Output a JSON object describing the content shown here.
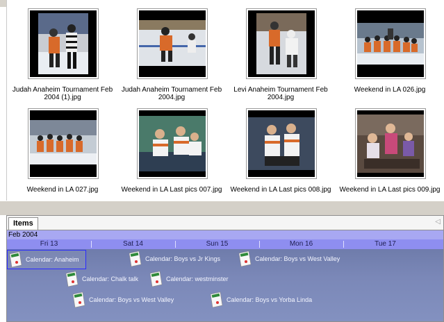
{
  "thumbnails": [
    {
      "caption": "Judah Anaheim Tournament Feb 2004 (1).jpg",
      "icon": "hockey-photo-icon"
    },
    {
      "caption": "Judah Anaheim Tournament Feb 2004.jpg",
      "icon": "hockey-photo-icon"
    },
    {
      "caption": "Levi Anaheim Tournament Feb 2004.jpg",
      "icon": "hockey-photo-icon"
    },
    {
      "caption": "Weekend in LA 026.jpg",
      "icon": "team-photo-icon"
    },
    {
      "caption": "Weekend in LA 027.jpg",
      "icon": "team-photo-icon"
    },
    {
      "caption": "Weekend in LA Last pics 007.jpg",
      "icon": "players-photo-icon"
    },
    {
      "caption": "Weekend in LA Last pics 008.jpg",
      "icon": "players-photo-icon"
    },
    {
      "caption": "Weekend in LA Last pics 009.jpg",
      "icon": "kids-photo-icon"
    }
  ],
  "items_pane": {
    "tab_label": "Items",
    "month_label": "Feb 2004",
    "days": [
      "Fri 13",
      "Sat 14",
      "Sun 15",
      "Mon 16",
      "Tue 17"
    ],
    "events": [
      {
        "label": "Calendar: Anaheim",
        "selected": true
      },
      {
        "label": "Calendar: Boys vs Jr Kings",
        "selected": false
      },
      {
        "label": "Calendar: Boys vs West Valley",
        "selected": false
      },
      {
        "label": "Calendar: Chalk talk",
        "selected": false
      },
      {
        "label": "Calendar: westminster",
        "selected": false
      },
      {
        "label": "Calendar: Boys vs West Valley",
        "selected": false
      },
      {
        "label": "Calendar: Boys vs Yorba Linda",
        "selected": false
      }
    ]
  },
  "colors": {
    "month_bar": "#a8a8f2",
    "day_bar": "#8e8ef0",
    "timeline": "#7b88b8",
    "selection": "#2a2aff"
  }
}
